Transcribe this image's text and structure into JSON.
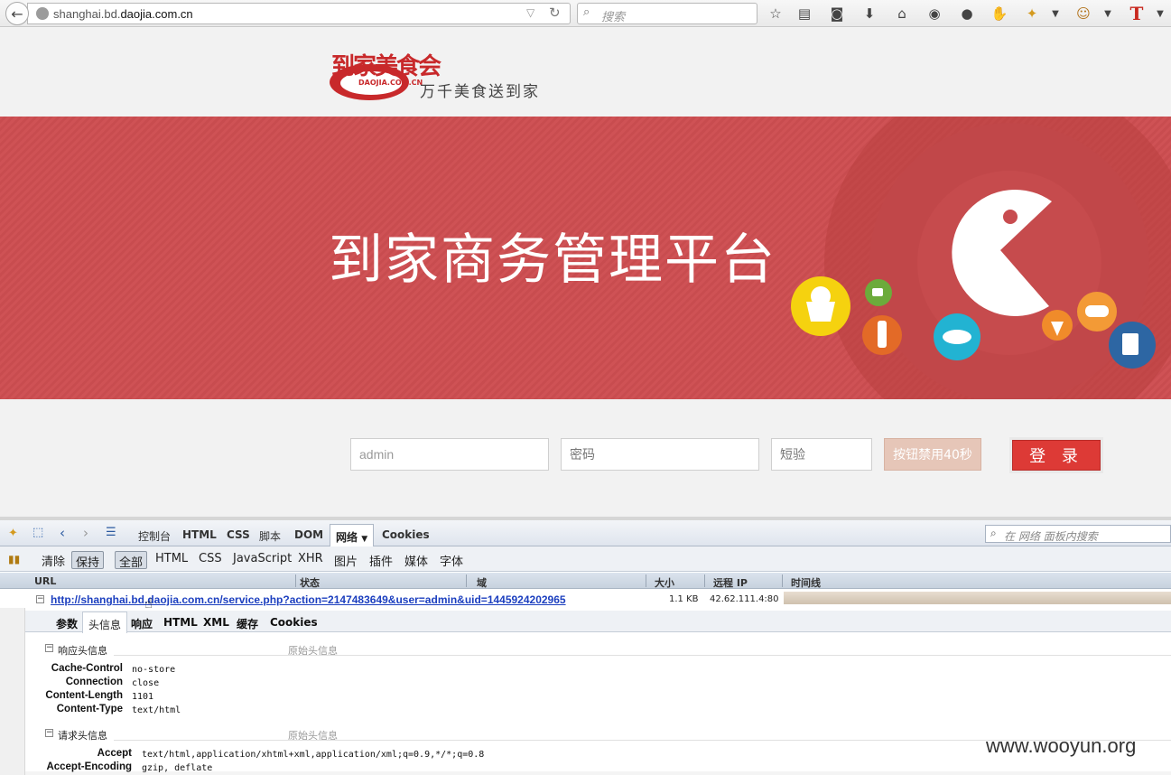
{
  "browser": {
    "url_prefix": "shanghai.bd.",
    "url_domain": "daojia.com.cn",
    "search_placeholder": "搜索"
  },
  "page": {
    "logo_text": "到家美食会",
    "logo_sub": "DAOJIA.COM.CN",
    "slogan": "万千美食送到家",
    "banner_title": "到家商务管理平台",
    "username_value": "admin",
    "password_placeholder": "密码",
    "sms_placeholder": "短验",
    "sms_button": "按钮禁用40秒",
    "login_button": "登 录",
    "banner_color": "#cf5255",
    "login_color": "#dd3a36"
  },
  "firebug": {
    "tabs": [
      "控制台",
      "HTML",
      "CSS",
      "脚本",
      "DOM",
      "网络",
      "Cookies"
    ],
    "search_placeholder": "在 网络 面板内搜索",
    "toolbar": [
      "清除",
      "保持",
      "全部",
      "HTML",
      "CSS",
      "JavaScript",
      "XHR",
      "图片",
      "插件",
      "媒体",
      "字体"
    ],
    "columns": [
      "URL",
      "状态",
      "域",
      "大小",
      "远程 IP",
      "时间线"
    ],
    "request": {
      "url": "http://shanghai.bd.daojia.com.cn/service.php?action=2147483649&user=admin&uid=1445924202965",
      "size": "1.1 KB",
      "remote_ip": "42.62.111.4:80"
    },
    "subtabs": [
      "参数",
      "头信息",
      "响应",
      "HTML",
      "XML",
      "缓存",
      "Cookies"
    ],
    "response_headers_title": "响应头信息",
    "request_headers_title": "请求头信息",
    "raw_label": "原始头信息",
    "response_headers": [
      {
        "name": "Cache-Control",
        "value": "no-store"
      },
      {
        "name": "Connection",
        "value": "close"
      },
      {
        "name": "Content-Length",
        "value": "1101"
      },
      {
        "name": "Content-Type",
        "value": "text/html"
      }
    ],
    "request_headers": [
      {
        "name": "Accept",
        "value": "text/html,application/xhtml+xml,application/xml;q=0.9,*/*;q=0.8"
      },
      {
        "name": "Accept-Encoding",
        "value": "gzip, deflate"
      }
    ]
  },
  "watermark": "www.wooyun.org"
}
